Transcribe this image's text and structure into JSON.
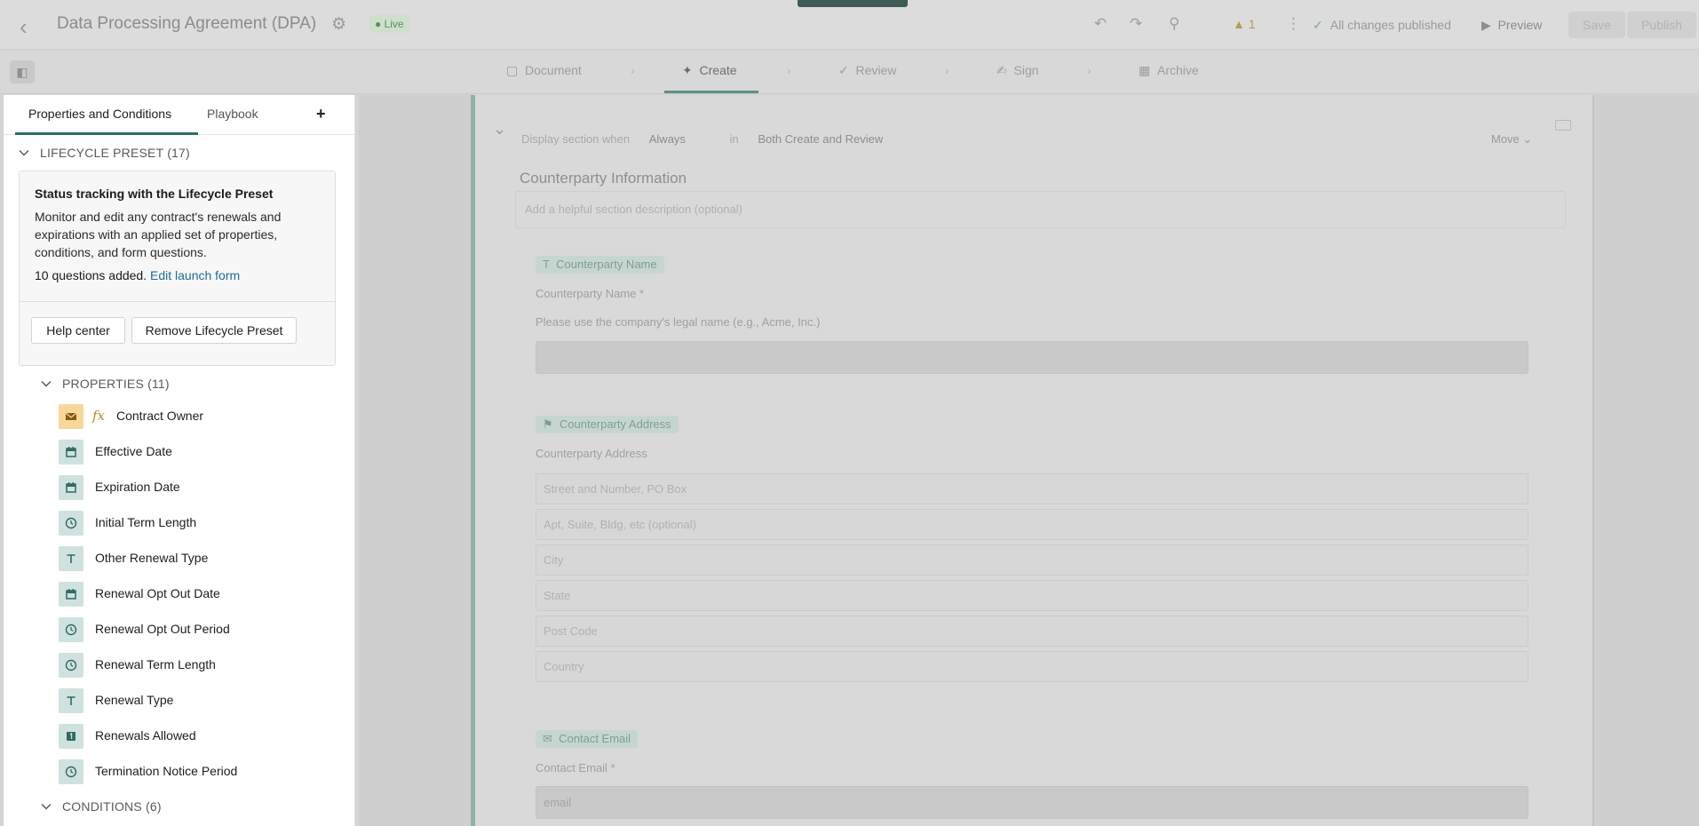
{
  "topbar": {
    "back_icon": "chevron-left-icon",
    "doc_title": "Data Processing Agreement (DPA)",
    "status_badge": "Live",
    "warning_count": "1",
    "publish_status": "All changes published",
    "preview_label": "Preview",
    "save_label": "Save",
    "publish_label": "Publish"
  },
  "steps": [
    {
      "label": "Document",
      "icon": "document-icon"
    },
    {
      "label": "Create",
      "icon": "sparkle-icon",
      "active": true
    },
    {
      "label": "Review",
      "icon": "check-icon"
    },
    {
      "label": "Sign",
      "icon": "signature-icon"
    },
    {
      "label": "Archive",
      "icon": "archive-icon"
    }
  ],
  "panel": {
    "tabs": [
      "Properties and Conditions",
      "Playbook"
    ],
    "add_tab_label": "+",
    "lifecycle_header": "LIFECYCLE PRESET (17)",
    "info": {
      "title": "Status tracking with the Lifecycle Preset",
      "body": "Monitor and edit any contract's renewals and expirations with an applied set of properties, conditions, and form questions.",
      "count_text": "10 questions added.",
      "link_text": "Edit launch form",
      "help_button": "Help center",
      "remove_button": "Remove Lifecycle Preset"
    },
    "properties_header": "PROPERTIES (11)",
    "properties": [
      {
        "label": "Contract Owner",
        "type": "email",
        "formula": true
      },
      {
        "label": "Effective Date",
        "type": "date"
      },
      {
        "label": "Expiration Date",
        "type": "date"
      },
      {
        "label": "Initial Term Length",
        "type": "duration"
      },
      {
        "label": "Other Renewal Type",
        "type": "text"
      },
      {
        "label": "Renewal Opt Out Date",
        "type": "date"
      },
      {
        "label": "Renewal Opt Out Period",
        "type": "duration"
      },
      {
        "label": "Renewal Term Length",
        "type": "duration"
      },
      {
        "label": "Renewal Type",
        "type": "text"
      },
      {
        "label": "Renewals Allowed",
        "type": "number"
      },
      {
        "label": "Termination Notice Period",
        "type": "duration"
      }
    ],
    "formula_symbol": "fx",
    "conditions_header": "CONDITIONS (6)"
  },
  "canvas": {
    "display_when_label": "Display section when",
    "display_when_value": "Always",
    "in_label": "in",
    "in_value": "Both Create and Review",
    "move_label": "Move",
    "section_title": "Counterparty Information",
    "section_desc_placeholder": "Add a helpful section description (optional)",
    "q1_chip": "Counterparty Name",
    "q1_label": "Counterparty Name *",
    "q1_help": "Please use the company's legal name (e.g., Acme, Inc.)",
    "q2_chip": "Counterparty Address",
    "q2_label": "Counterparty Address",
    "address_fields": [
      "Street and Number, PO Box",
      "Apt, Suite, Bldg, etc (optional)",
      "City",
      "State",
      "Post Code",
      "Country"
    ],
    "q3_chip": "Contact Email",
    "q3_label": "Contact Email *",
    "q3_value": "email"
  }
}
